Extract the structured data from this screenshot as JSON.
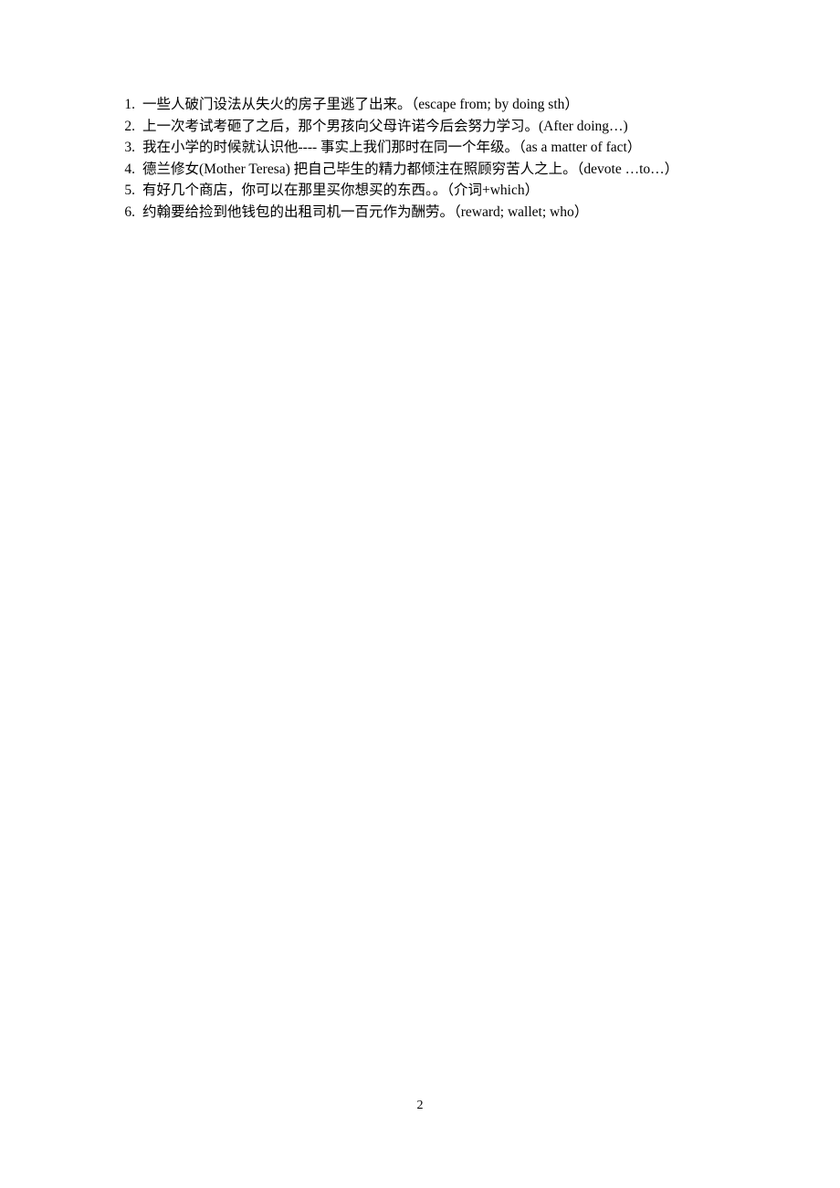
{
  "document": {
    "page_number": "2",
    "exercises": [
      {
        "number": "1.",
        "text": "一些人破门设法从失火的房子里逃了出来。（escape from; by doing sth）"
      },
      {
        "number": "2.",
        "text": "上一次考试考砸了之后，那个男孩向父母许诺今后会努力学习。(After doing…)"
      },
      {
        "number": "3.",
        "text": "我在小学的时候就认识他---- 事实上我们那时在同一个年级。（as a matter of fact）"
      },
      {
        "number": "4.",
        "text": "德兰修女(Mother Teresa) 把自己毕生的精力都倾注在照顾穷苦人之上。（devote …to…）"
      },
      {
        "number": "5.",
        "text": "有好几个商店，你可以在那里买你想买的东西。。（介词+which）"
      },
      {
        "number": "6.",
        "text": "约翰要给捡到他钱包的出租司机一百元作为酬劳。（reward; wallet; who）"
      }
    ]
  }
}
